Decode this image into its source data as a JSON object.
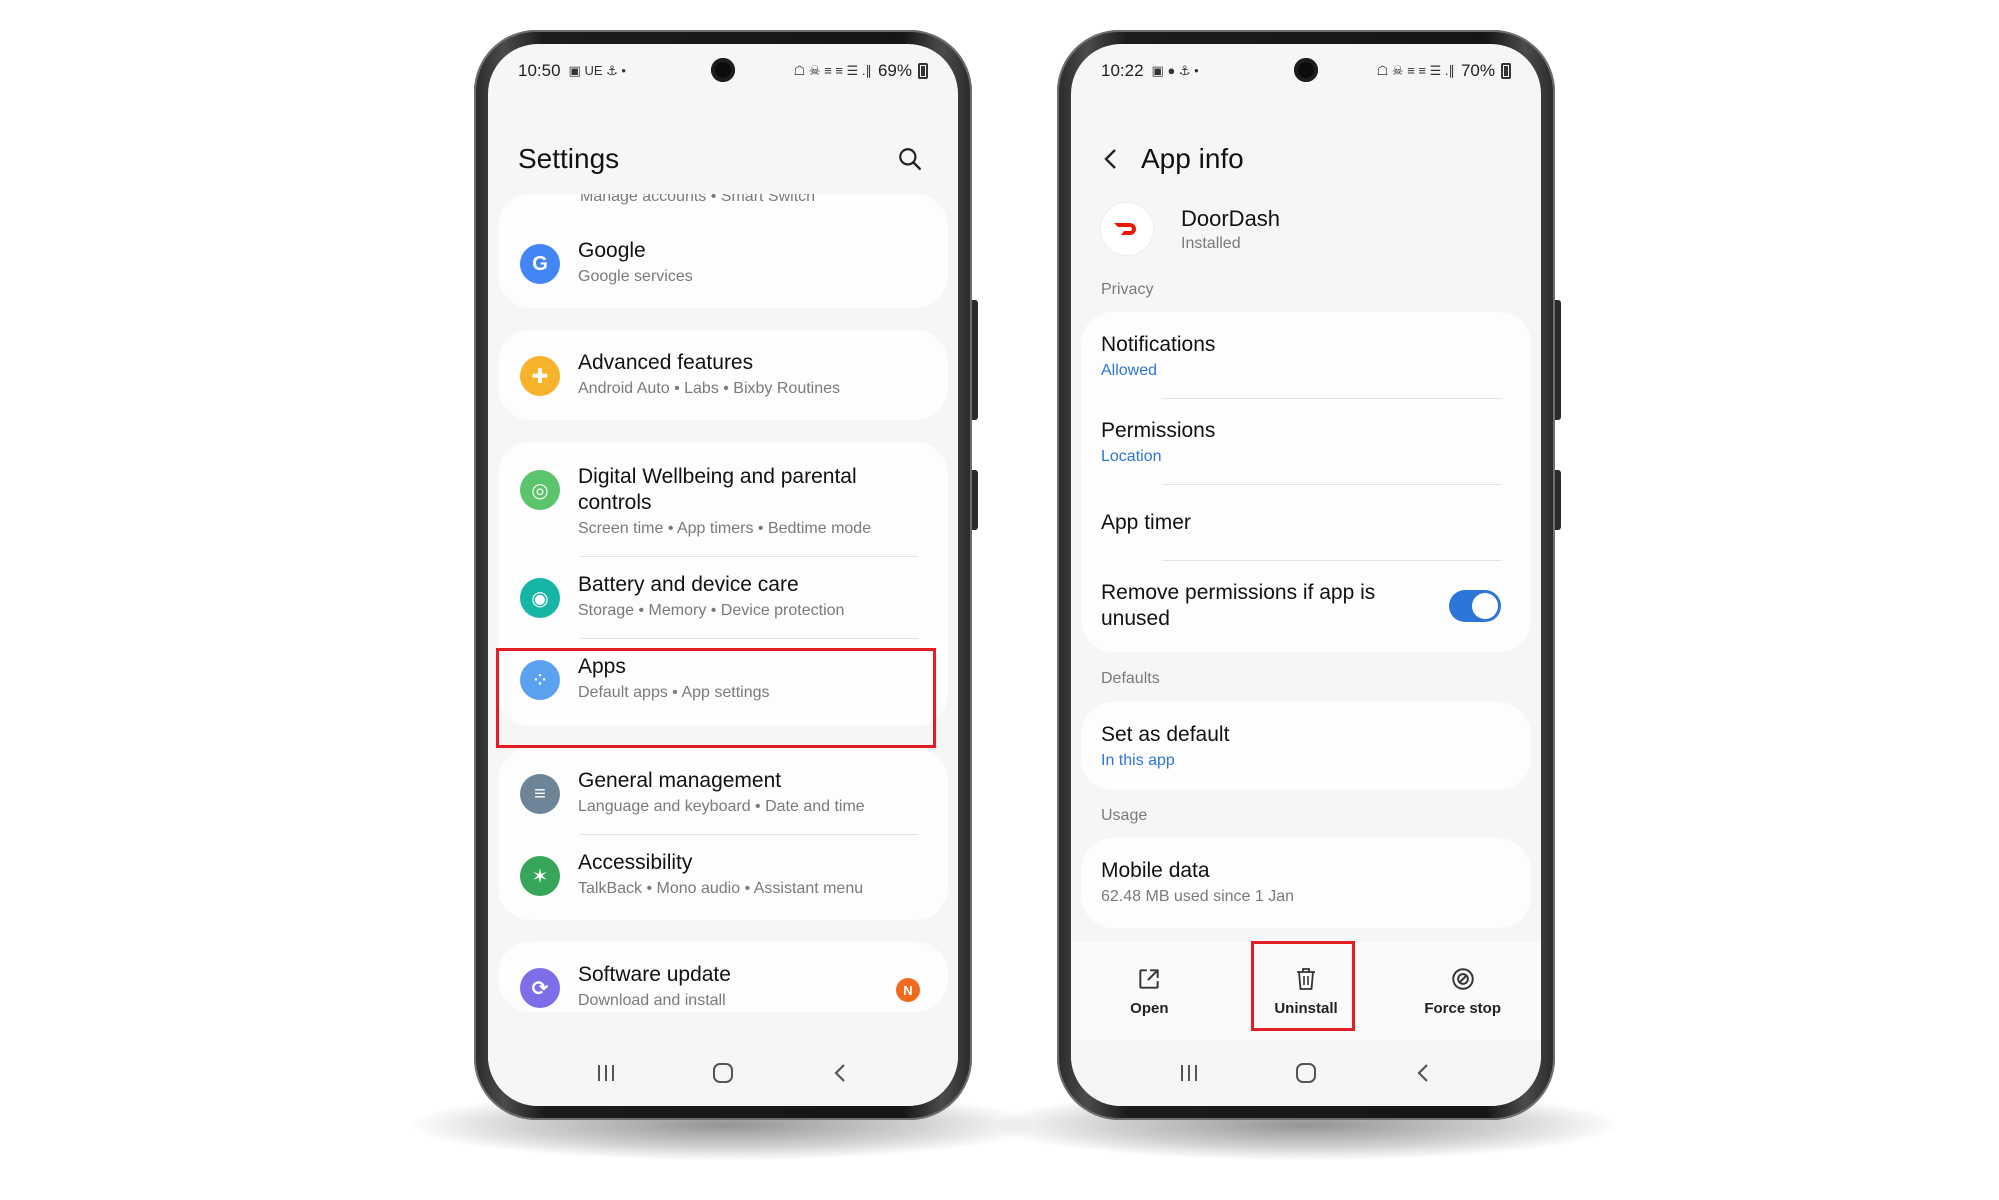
{
  "left_phone": {
    "status": {
      "time": "10:50",
      "battery": "69%",
      "left_glyphs": "▣ UE ⚓ •",
      "right_glyphs": "☖ ☠ ≡ ≡ ☰ .∥"
    },
    "title": "Settings",
    "cut_row": "Manage accounts • Smart Switch",
    "items": [
      {
        "main": "Google",
        "sub": "Google services",
        "icon": "google-icon",
        "color": "#4285f4"
      },
      {
        "main": "Advanced features",
        "sub": "Android Auto  •  Labs  •  Bixby Routines",
        "icon": "gear-plus-icon",
        "color": "#f7b32b"
      },
      {
        "main": "Digital Wellbeing and parental controls",
        "sub": "Screen time  •  App timers  •  Bedtime mode",
        "icon": "wellbeing-icon",
        "color": "#5cc46a"
      },
      {
        "main": "Battery and device care",
        "sub": "Storage  •  Memory  •  Device protection",
        "icon": "device-care-icon",
        "color": "#16b5a5"
      },
      {
        "main": "Apps",
        "sub": "Default apps  •  App settings",
        "icon": "apps-icon",
        "color": "#5aa2f0"
      },
      {
        "main": "General management",
        "sub": "Language and keyboard  •  Date and time",
        "icon": "sliders-icon",
        "color": "#6d8499"
      },
      {
        "main": "Accessibility",
        "sub": "TalkBack  •  Mono audio  •  Assistant menu",
        "icon": "accessibility-icon",
        "color": "#37a55a"
      },
      {
        "main": "Software update",
        "sub": "Download and install",
        "icon": "software-update-icon",
        "color": "#7d6ee8",
        "badge": "N"
      }
    ]
  },
  "right_phone": {
    "status": {
      "time": "10:22",
      "battery": "70%",
      "left_glyphs": "▣ ● ⚓ •",
      "right_glyphs": "☖ ☠ ≡ ≡ ☰ .∥"
    },
    "title": "App info",
    "app_name": "DoorDash",
    "app_status": "Installed",
    "sections": {
      "privacy": "Privacy",
      "defaults": "Defaults",
      "usage": "Usage"
    },
    "notifications": {
      "main": "Notifications",
      "sub": "Allowed"
    },
    "permissions": {
      "main": "Permissions",
      "sub": "Location"
    },
    "app_timer": {
      "main": "App timer"
    },
    "remove_permissions": {
      "main": "Remove permissions if app is unused",
      "enabled": true
    },
    "set_default": {
      "main": "Set as default",
      "sub": "In this app"
    },
    "mobile_data": {
      "main": "Mobile data",
      "sub": "62.48 MB used since 1 Jan"
    },
    "actions": {
      "open": "Open",
      "uninstall": "Uninstall",
      "force_stop": "Force stop"
    }
  },
  "colors": {
    "highlight": "#e41d25",
    "accent_blue": "#2d76d8",
    "doordash_red": "#eb1700"
  }
}
